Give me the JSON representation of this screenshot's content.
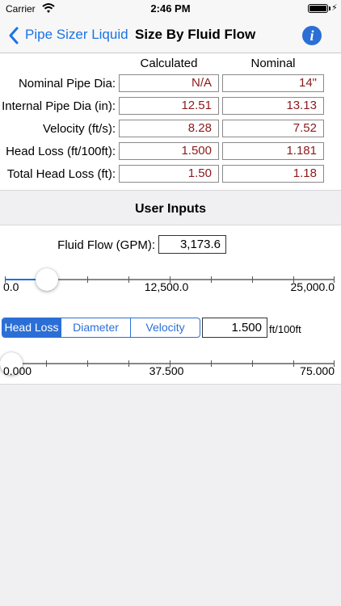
{
  "status_bar": {
    "carrier": "Carrier",
    "time": "2:46 PM",
    "bolt": "⚡"
  },
  "nav": {
    "back_label": "Pipe Sizer Liquid",
    "title": "Size By Fluid Flow",
    "info_label": "i"
  },
  "results": {
    "col_calculated": "Calculated",
    "col_nominal": "Nominal",
    "rows": [
      {
        "label": "Nominal Pipe Dia:",
        "calculated": "N/A",
        "nominal": "14\""
      },
      {
        "label": "Internal Pipe Dia (in):",
        "calculated": "12.51",
        "nominal": "13.13"
      },
      {
        "label": "Velocity (ft/s):",
        "calculated": "8.28",
        "nominal": "7.52"
      },
      {
        "label": "Head Loss (ft/100ft):",
        "calculated": "1.500",
        "nominal": "1.181"
      },
      {
        "label": "Total Head Loss (ft):",
        "calculated": "1.50",
        "nominal": "1.18"
      }
    ]
  },
  "user_inputs": {
    "header": "User Inputs",
    "flow_label": "Fluid Flow (GPM):",
    "flow_value": "3,173.6",
    "flow_slider": {
      "min_label": "0.0",
      "mid_label": "12,500.0",
      "max_label": "25,000.0",
      "level": 0.127
    },
    "segments": [
      "Head Loss",
      "Diameter",
      "Velocity"
    ],
    "selected_segment": "Head Loss",
    "param_value": "1.500",
    "param_unit": "ft/100ft",
    "param_slider": {
      "min_label": "0.000",
      "mid_label": "37.500",
      "max_label": "75.000",
      "level": 0.02
    }
  },
  "colors": {
    "accent": "#2b6fd6",
    "back_link": "#1a73e8",
    "result_text": "#8b1a1a"
  }
}
